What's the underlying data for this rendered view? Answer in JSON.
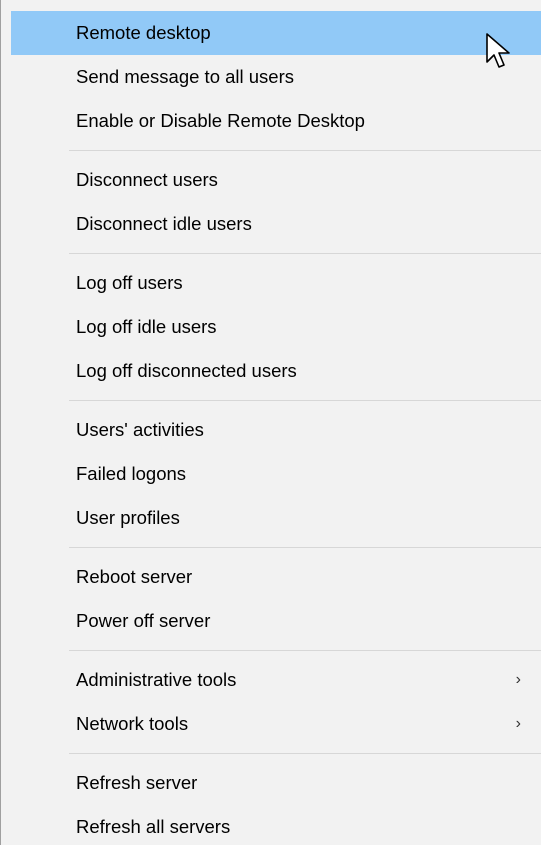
{
  "context_menu": {
    "groups": [
      {
        "items": [
          {
            "label": "Remote desktop",
            "highlighted": true
          },
          {
            "label": "Send message to all users"
          },
          {
            "label": "Enable or Disable Remote Desktop"
          }
        ]
      },
      {
        "items": [
          {
            "label": "Disconnect users"
          },
          {
            "label": "Disconnect idle users"
          }
        ]
      },
      {
        "items": [
          {
            "label": "Log off users"
          },
          {
            "label": "Log off idle users"
          },
          {
            "label": "Log off disconnected users"
          }
        ]
      },
      {
        "items": [
          {
            "label": "Users' activities"
          },
          {
            "label": "Failed logons"
          },
          {
            "label": "User profiles"
          }
        ]
      },
      {
        "items": [
          {
            "label": "Reboot server"
          },
          {
            "label": "Power off server"
          }
        ]
      },
      {
        "items": [
          {
            "label": "Administrative tools",
            "submenu": true,
            "submenu_icon": "chevron-right-icon"
          },
          {
            "label": "Network tools",
            "submenu": true,
            "submenu_icon": "chevron-right-icon"
          }
        ]
      },
      {
        "items": [
          {
            "label": "Refresh server"
          },
          {
            "label": "Refresh all servers"
          }
        ]
      }
    ],
    "highlight_color": "#91c9f7",
    "background_color": "#f2f2f2",
    "chevron_glyph": "›"
  },
  "mouse_cursor": {
    "icon": "arrow-cursor-icon"
  }
}
